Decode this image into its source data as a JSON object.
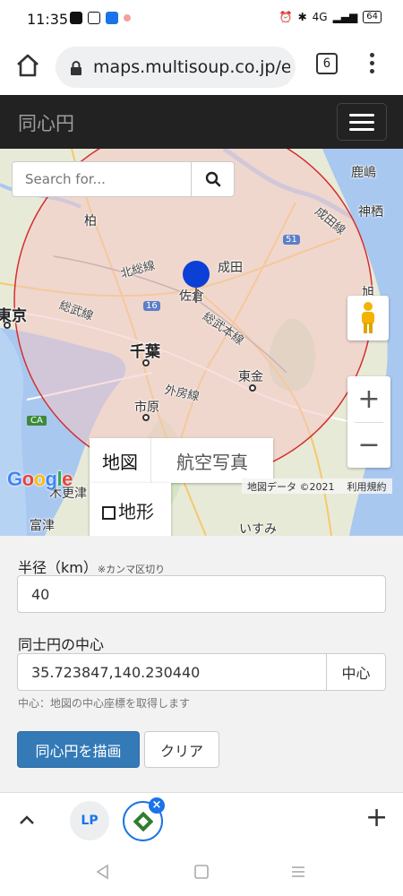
{
  "status_bar": {
    "time": "11:35",
    "network_label": "4G",
    "battery": "64"
  },
  "browser": {
    "url": "maps.multisoup.co.jp/ex",
    "tab_count": "6"
  },
  "navbar": {
    "brand": "同心円"
  },
  "map": {
    "search_placeholder": "Search for...",
    "labels": {
      "kashima": "鹿嶋",
      "kamisu": "神栖",
      "kashiwa": "柏",
      "narita_line": "成田線",
      "hokuso_line": "北総線",
      "narita": "成田",
      "sakura": "佐倉",
      "sobu_line": "総武線",
      "sobu_main_line": "総武本線",
      "tokyo": "東京",
      "chiba": "千葉",
      "togane": "東金",
      "sotobo_line": "外房線",
      "ichihara": "市原",
      "kisarazu": "木更津",
      "futtsu": "富津",
      "isumi": "いすみ",
      "route_16": "16",
      "route_51": "51",
      "ca": "CA",
      "asahi": "旭"
    },
    "map_type_map": "地図",
    "map_type_satellite": "航空写真",
    "map_type_terrain": "地形",
    "google_logo": "Google",
    "attribution": "地図データ ©2021",
    "terms": "利用規約",
    "zoom_in": "+",
    "zoom_out": "−",
    "circle_color": "#d32f2f",
    "fill_color": "#f4c7c7",
    "marker_color": "#0b3fd6"
  },
  "form": {
    "radius_label": "半径（km）",
    "radius_note": "※カンマ区切り",
    "radius_value": "40",
    "center_label": "同士円の中心",
    "center_value": "35.723847,140.230440",
    "center_button": "中心",
    "help_text": "中心：地図の中心座標を取得します",
    "draw_button": "同心円を描画",
    "clear_button": "クリア",
    "accent_color": "#337ab7"
  },
  "bottom_toolbar": {
    "tab1_icon": "LP",
    "close_icon": "×",
    "plus": "+"
  }
}
